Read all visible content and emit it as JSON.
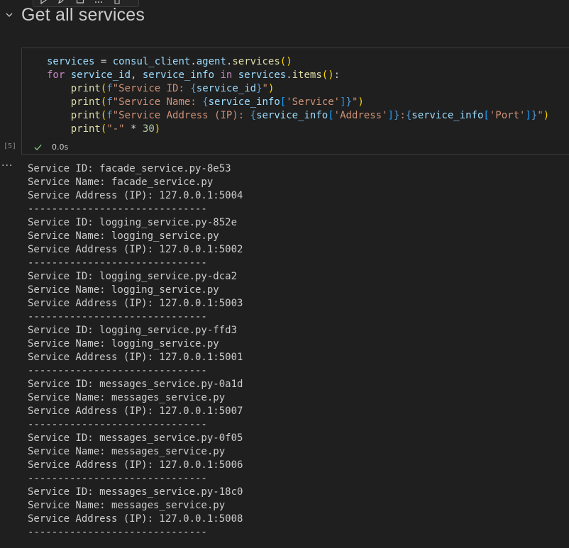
{
  "heading": {
    "title": "Get all services"
  },
  "cell": {
    "execution_count": "[5]",
    "exec_time": "0.0s",
    "status_icon": "check-icon",
    "code": {
      "l1": {
        "a": "services",
        "b": " = ",
        "c": "consul_client",
        "d": ".",
        "e": "agent",
        "f": ".",
        "g": "services",
        "h": "()"
      },
      "l2": {
        "kw1": "for",
        "v1": " service_id",
        "sep": ", ",
        "v2": "service_info",
        "kw2": " in ",
        "v3": "services",
        "dot": ".",
        "fn": "items",
        "par": "()",
        "colon": ":"
      },
      "l3": {
        "fn": "print",
        "p1": "(",
        "f": "f",
        "s1": "\"Service ID: ",
        "b1": "{",
        "v": "service_id",
        "b2": "}",
        "s2": "\"",
        "p2": ")"
      },
      "l4": {
        "fn": "print",
        "p1": "(",
        "f": "f",
        "s1": "\"Service Name: ",
        "b1": "{",
        "v": "service_info",
        "k1": "[",
        "k": "'Service'",
        "k2": "]",
        "b2": "}",
        "s2": "\"",
        "p2": ")"
      },
      "l5": {
        "fn": "print",
        "p1": "(",
        "f": "f",
        "s1": "\"Service Address (IP): ",
        "b1": "{",
        "v1": "service_info",
        "k1a": "[",
        "k1": "'Address'",
        "k1b": "]",
        "b2": "}",
        "colon": ":",
        "b3": "{",
        "v2": "service_info",
        "k2a": "[",
        "k2": "'Port'",
        "k2b": "]",
        "b4": "}",
        "s2": "\"",
        "p2": ")"
      },
      "l6": {
        "fn": "print",
        "p1": "(",
        "s": "\"-\"",
        "op": " * ",
        "n": "30",
        "p2": ")"
      }
    }
  },
  "output": {
    "more_icon": "ellipsis-icon",
    "lines": [
      "Service ID: facade_service.py-8e53",
      "Service Name: facade_service.py",
      "Service Address (IP): 127.0.0.1:5004",
      "------------------------------",
      "Service ID: logging_service.py-852e",
      "Service Name: logging_service.py",
      "Service Address (IP): 127.0.0.1:5002",
      "------------------------------",
      "Service ID: logging_service.py-dca2",
      "Service Name: logging_service.py",
      "Service Address (IP): 127.0.0.1:5003",
      "------------------------------",
      "Service ID: logging_service.py-ffd3",
      "Service Name: logging_service.py",
      "Service Address (IP): 127.0.0.1:5001",
      "------------------------------",
      "Service ID: messages_service.py-0a1d",
      "Service Name: messages_service.py",
      "Service Address (IP): 127.0.0.1:5007",
      "------------------------------",
      "Service ID: messages_service.py-0f05",
      "Service Name: messages_service.py",
      "Service Address (IP): 127.0.0.1:5006",
      "------------------------------",
      "Service ID: messages_service.py-18c0",
      "Service Name: messages_service.py",
      "Service Address (IP): 127.0.0.1:5008",
      "------------------------------"
    ]
  }
}
